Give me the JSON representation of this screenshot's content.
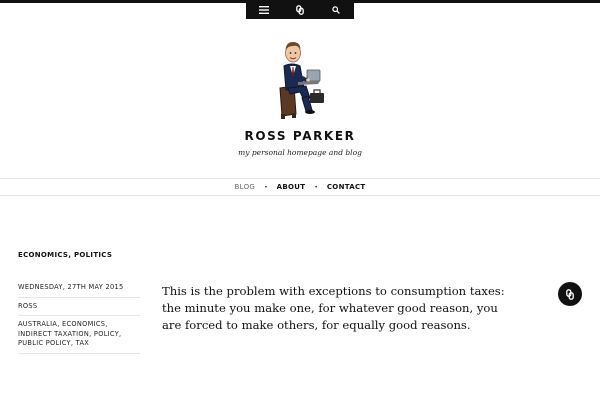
{
  "toolbar": {
    "buttons": [
      {
        "icon": "menu-icon"
      },
      {
        "icon": "link-icon"
      },
      {
        "icon": "search-icon"
      }
    ]
  },
  "site": {
    "title": "ROSS PARKER",
    "tagline": "my personal homepage and blog"
  },
  "nav": {
    "items": [
      {
        "label": "BLOG",
        "active": true
      },
      {
        "label": "ABOUT",
        "active": false
      },
      {
        "label": "CONTACT",
        "active": false
      }
    ],
    "separator": "•"
  },
  "post": {
    "categories": [
      "ECONOMICS",
      "POLITICS"
    ],
    "category_separator": ", ",
    "date": "WEDNESDAY, 27TH MAY 2015",
    "author": "ROSS",
    "tags": [
      "AUSTRALIA",
      "ECONOMICS",
      "INDIRECT TAXATION",
      "POLICY",
      "PUBLIC POLICY",
      "TAX"
    ],
    "body": "This is the problem with exceptions to consumption taxes: the minute you make one, for whatever good reason, you are forced to make others, for equally good reasons.",
    "format_icon": "link-icon"
  },
  "colors": {
    "toolbar_bg": "#111111",
    "text": "#111111",
    "nav_active": "#666666",
    "rule": "#e4e4e4"
  }
}
